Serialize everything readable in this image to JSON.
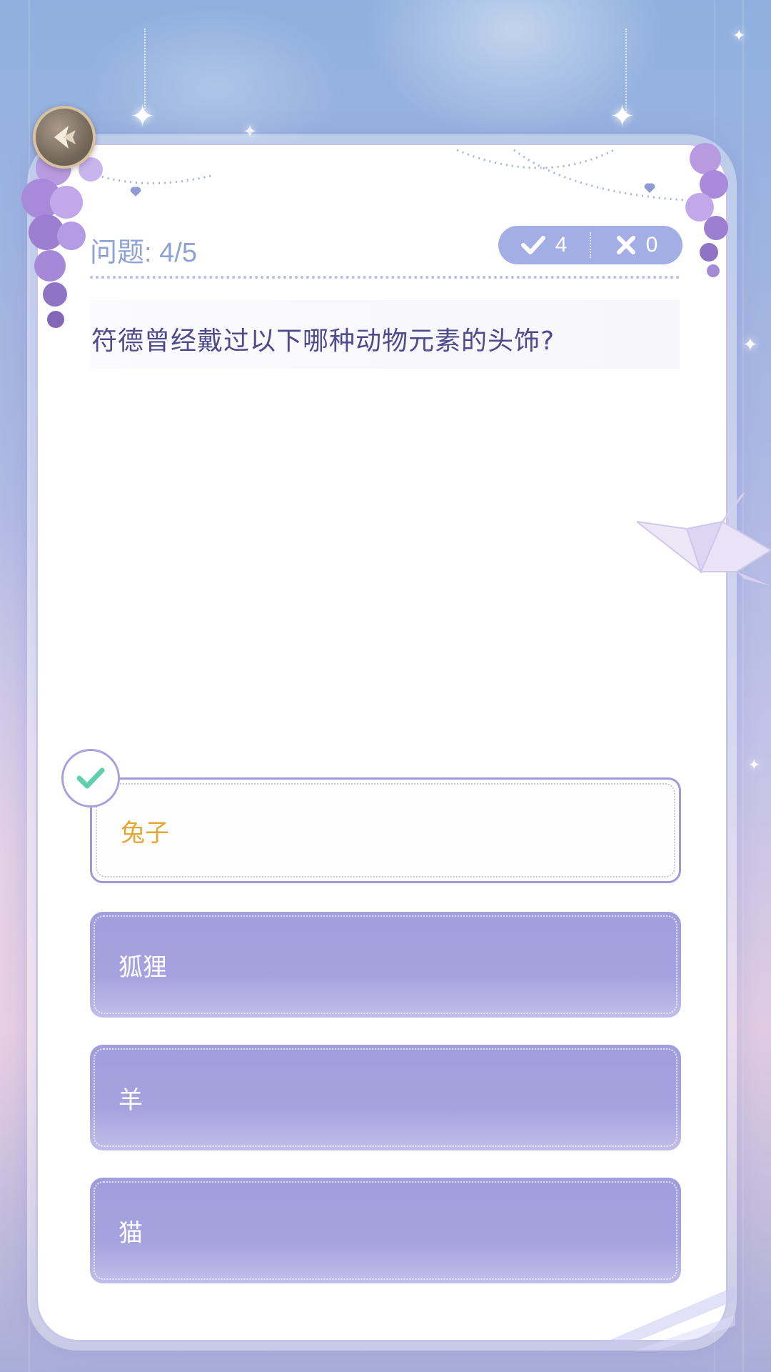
{
  "header": {
    "question_label": "问题",
    "question_progress": "4/5",
    "score": {
      "correct": "4",
      "wrong": "0"
    }
  },
  "question": {
    "text": "符德曾经戴过以下哪种动物元素的头饰?"
  },
  "options": [
    {
      "label": "兔子",
      "state": "selected-correct"
    },
    {
      "label": "狐狸",
      "state": "normal"
    },
    {
      "label": "羊",
      "state": "normal"
    },
    {
      "label": "猫",
      "state": "normal"
    }
  ],
  "icons": {
    "back": "back-arrow-icon",
    "correct": "check-icon",
    "wrong": "cross-icon",
    "selected": "check-badge-icon",
    "decoration": "paper-crane-icon"
  },
  "colors": {
    "accent": "#a29ddd",
    "selected_text": "#e6a632",
    "question_text": "#4e4a8c",
    "check_green": "#5fcfae"
  }
}
